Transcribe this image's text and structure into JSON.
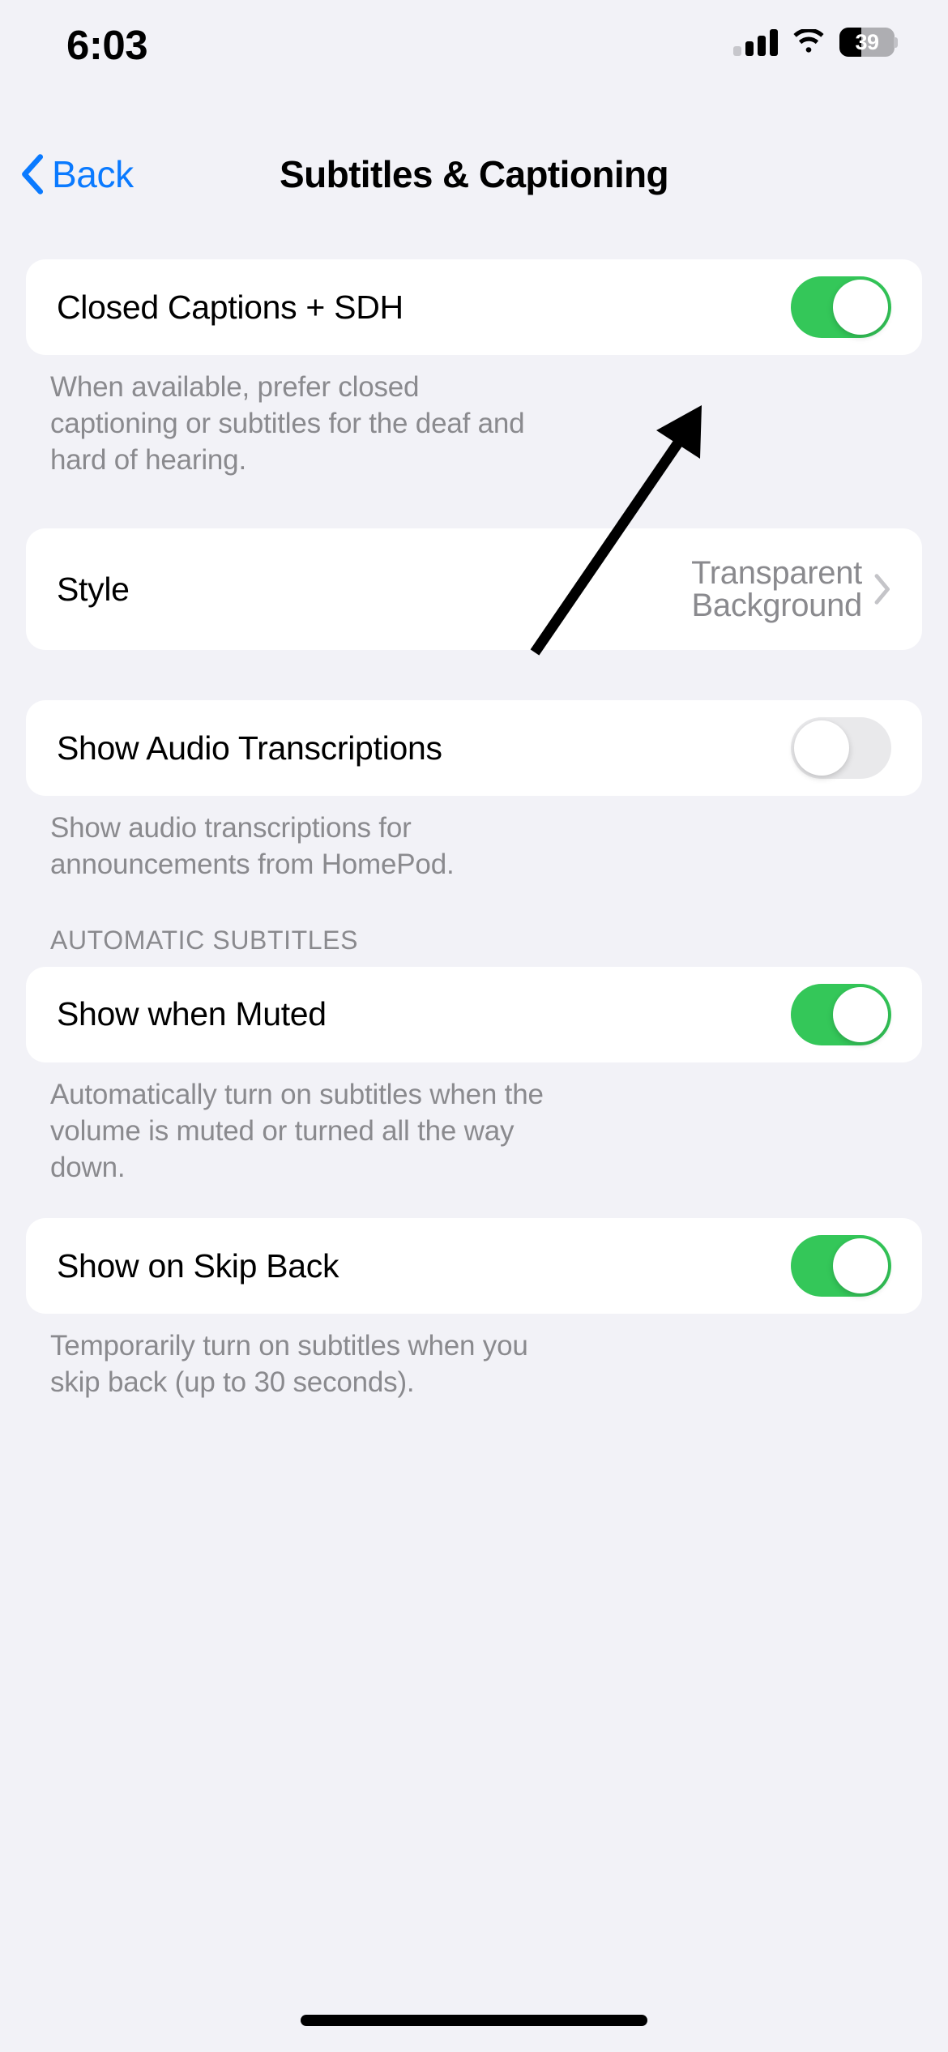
{
  "status_bar": {
    "time": "6:03",
    "cellular_icon": "cellular-bars-icon",
    "wifi_icon": "wifi-icon",
    "battery_icon": "battery-icon",
    "battery_percent": "39",
    "battery_fill_ratio": 0.39
  },
  "nav": {
    "back_label": "Back",
    "back_icon": "chevron-left-icon",
    "title": "Subtitles & Captioning"
  },
  "colors": {
    "page_background": "#F2F2F7",
    "card_background": "#FFFFFF",
    "accent_blue": "#0A7AFF",
    "toggle_on_green": "#34C759",
    "toggle_off_gray": "#E9E9EB",
    "secondary_text": "#8A8A8E",
    "annotation_arrow": "#000000"
  },
  "sections": [
    {
      "rows": [
        {
          "label": "Closed Captions + SDH",
          "control": "toggle",
          "value": "on"
        }
      ],
      "footer": "When available, prefer closed captioning or subtitles for the deaf and hard of hearing."
    },
    {
      "rows": [
        {
          "label": "Style",
          "control": "disclosure",
          "value": "Transparent Background",
          "chevron_icon": "chevron-right-icon"
        }
      ],
      "footer": ""
    },
    {
      "rows": [
        {
          "label": "Show Audio Transcriptions",
          "control": "toggle",
          "value": "off"
        }
      ],
      "footer": "Show audio transcriptions for announcements from HomePod."
    },
    {
      "header": "AUTOMATIC SUBTITLES",
      "rows": [
        {
          "label": "Show when Muted",
          "control": "toggle",
          "value": "on"
        }
      ],
      "footer": "Automatically turn on subtitles when the volume is muted or turned all the way down."
    },
    {
      "rows": [
        {
          "label": "Show on Skip Back",
          "control": "toggle",
          "value": "on"
        }
      ],
      "footer": "Temporarily turn on subtitles when you skip back (up to 30 seconds)."
    }
  ],
  "annotation": {
    "arrow_icon": "annotation-arrow-icon",
    "points_to": "Closed Captions + SDH footer text"
  },
  "home_indicator": "home-indicator"
}
